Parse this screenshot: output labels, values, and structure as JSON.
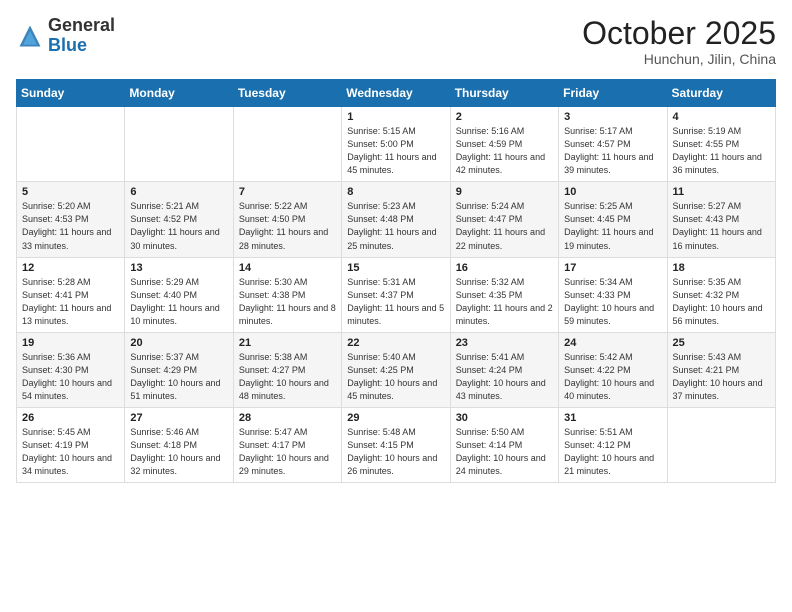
{
  "logo": {
    "general": "General",
    "blue": "Blue"
  },
  "header": {
    "month": "October 2025",
    "location": "Hunchun, Jilin, China"
  },
  "weekdays": [
    "Sunday",
    "Monday",
    "Tuesday",
    "Wednesday",
    "Thursday",
    "Friday",
    "Saturday"
  ],
  "weeks": [
    [
      {
        "day": "",
        "sunrise": "",
        "sunset": "",
        "daylight": ""
      },
      {
        "day": "",
        "sunrise": "",
        "sunset": "",
        "daylight": ""
      },
      {
        "day": "",
        "sunrise": "",
        "sunset": "",
        "daylight": ""
      },
      {
        "day": "1",
        "sunrise": "Sunrise: 5:15 AM",
        "sunset": "Sunset: 5:00 PM",
        "daylight": "Daylight: 11 hours and 45 minutes."
      },
      {
        "day": "2",
        "sunrise": "Sunrise: 5:16 AM",
        "sunset": "Sunset: 4:59 PM",
        "daylight": "Daylight: 11 hours and 42 minutes."
      },
      {
        "day": "3",
        "sunrise": "Sunrise: 5:17 AM",
        "sunset": "Sunset: 4:57 PM",
        "daylight": "Daylight: 11 hours and 39 minutes."
      },
      {
        "day": "4",
        "sunrise": "Sunrise: 5:19 AM",
        "sunset": "Sunset: 4:55 PM",
        "daylight": "Daylight: 11 hours and 36 minutes."
      }
    ],
    [
      {
        "day": "5",
        "sunrise": "Sunrise: 5:20 AM",
        "sunset": "Sunset: 4:53 PM",
        "daylight": "Daylight: 11 hours and 33 minutes."
      },
      {
        "day": "6",
        "sunrise": "Sunrise: 5:21 AM",
        "sunset": "Sunset: 4:52 PM",
        "daylight": "Daylight: 11 hours and 30 minutes."
      },
      {
        "day": "7",
        "sunrise": "Sunrise: 5:22 AM",
        "sunset": "Sunset: 4:50 PM",
        "daylight": "Daylight: 11 hours and 28 minutes."
      },
      {
        "day": "8",
        "sunrise": "Sunrise: 5:23 AM",
        "sunset": "Sunset: 4:48 PM",
        "daylight": "Daylight: 11 hours and 25 minutes."
      },
      {
        "day": "9",
        "sunrise": "Sunrise: 5:24 AM",
        "sunset": "Sunset: 4:47 PM",
        "daylight": "Daylight: 11 hours and 22 minutes."
      },
      {
        "day": "10",
        "sunrise": "Sunrise: 5:25 AM",
        "sunset": "Sunset: 4:45 PM",
        "daylight": "Daylight: 11 hours and 19 minutes."
      },
      {
        "day": "11",
        "sunrise": "Sunrise: 5:27 AM",
        "sunset": "Sunset: 4:43 PM",
        "daylight": "Daylight: 11 hours and 16 minutes."
      }
    ],
    [
      {
        "day": "12",
        "sunrise": "Sunrise: 5:28 AM",
        "sunset": "Sunset: 4:41 PM",
        "daylight": "Daylight: 11 hours and 13 minutes."
      },
      {
        "day": "13",
        "sunrise": "Sunrise: 5:29 AM",
        "sunset": "Sunset: 4:40 PM",
        "daylight": "Daylight: 11 hours and 10 minutes."
      },
      {
        "day": "14",
        "sunrise": "Sunrise: 5:30 AM",
        "sunset": "Sunset: 4:38 PM",
        "daylight": "Daylight: 11 hours and 8 minutes."
      },
      {
        "day": "15",
        "sunrise": "Sunrise: 5:31 AM",
        "sunset": "Sunset: 4:37 PM",
        "daylight": "Daylight: 11 hours and 5 minutes."
      },
      {
        "day": "16",
        "sunrise": "Sunrise: 5:32 AM",
        "sunset": "Sunset: 4:35 PM",
        "daylight": "Daylight: 11 hours and 2 minutes."
      },
      {
        "day": "17",
        "sunrise": "Sunrise: 5:34 AM",
        "sunset": "Sunset: 4:33 PM",
        "daylight": "Daylight: 10 hours and 59 minutes."
      },
      {
        "day": "18",
        "sunrise": "Sunrise: 5:35 AM",
        "sunset": "Sunset: 4:32 PM",
        "daylight": "Daylight: 10 hours and 56 minutes."
      }
    ],
    [
      {
        "day": "19",
        "sunrise": "Sunrise: 5:36 AM",
        "sunset": "Sunset: 4:30 PM",
        "daylight": "Daylight: 10 hours and 54 minutes."
      },
      {
        "day": "20",
        "sunrise": "Sunrise: 5:37 AM",
        "sunset": "Sunset: 4:29 PM",
        "daylight": "Daylight: 10 hours and 51 minutes."
      },
      {
        "day": "21",
        "sunrise": "Sunrise: 5:38 AM",
        "sunset": "Sunset: 4:27 PM",
        "daylight": "Daylight: 10 hours and 48 minutes."
      },
      {
        "day": "22",
        "sunrise": "Sunrise: 5:40 AM",
        "sunset": "Sunset: 4:25 PM",
        "daylight": "Daylight: 10 hours and 45 minutes."
      },
      {
        "day": "23",
        "sunrise": "Sunrise: 5:41 AM",
        "sunset": "Sunset: 4:24 PM",
        "daylight": "Daylight: 10 hours and 43 minutes."
      },
      {
        "day": "24",
        "sunrise": "Sunrise: 5:42 AM",
        "sunset": "Sunset: 4:22 PM",
        "daylight": "Daylight: 10 hours and 40 minutes."
      },
      {
        "day": "25",
        "sunrise": "Sunrise: 5:43 AM",
        "sunset": "Sunset: 4:21 PM",
        "daylight": "Daylight: 10 hours and 37 minutes."
      }
    ],
    [
      {
        "day": "26",
        "sunrise": "Sunrise: 5:45 AM",
        "sunset": "Sunset: 4:19 PM",
        "daylight": "Daylight: 10 hours and 34 minutes."
      },
      {
        "day": "27",
        "sunrise": "Sunrise: 5:46 AM",
        "sunset": "Sunset: 4:18 PM",
        "daylight": "Daylight: 10 hours and 32 minutes."
      },
      {
        "day": "28",
        "sunrise": "Sunrise: 5:47 AM",
        "sunset": "Sunset: 4:17 PM",
        "daylight": "Daylight: 10 hours and 29 minutes."
      },
      {
        "day": "29",
        "sunrise": "Sunrise: 5:48 AM",
        "sunset": "Sunset: 4:15 PM",
        "daylight": "Daylight: 10 hours and 26 minutes."
      },
      {
        "day": "30",
        "sunrise": "Sunrise: 5:50 AM",
        "sunset": "Sunset: 4:14 PM",
        "daylight": "Daylight: 10 hours and 24 minutes."
      },
      {
        "day": "31",
        "sunrise": "Sunrise: 5:51 AM",
        "sunset": "Sunset: 4:12 PM",
        "daylight": "Daylight: 10 hours and 21 minutes."
      },
      {
        "day": "",
        "sunrise": "",
        "sunset": "",
        "daylight": ""
      }
    ]
  ]
}
